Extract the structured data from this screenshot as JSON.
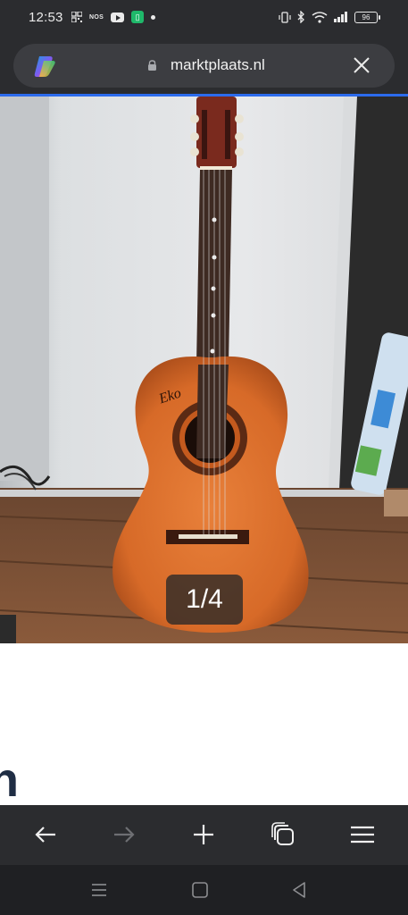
{
  "status_bar": {
    "time": "12:53",
    "nos_label": "NOS",
    "battery": "96"
  },
  "browser": {
    "url": "marktplaats.nl",
    "progress_color": "#2c6bed"
  },
  "gallery": {
    "counter": "1/4"
  },
  "content": {
    "heading_fragment": "n"
  },
  "icons": {
    "copilot": "copilot-icon",
    "lock": "lock-icon",
    "close": "close-icon",
    "back": "back-arrow-icon",
    "forward": "forward-arrow-icon",
    "new_tab": "plus-icon",
    "tabs": "tabs-icon",
    "menu": "hamburger-menu-icon"
  }
}
